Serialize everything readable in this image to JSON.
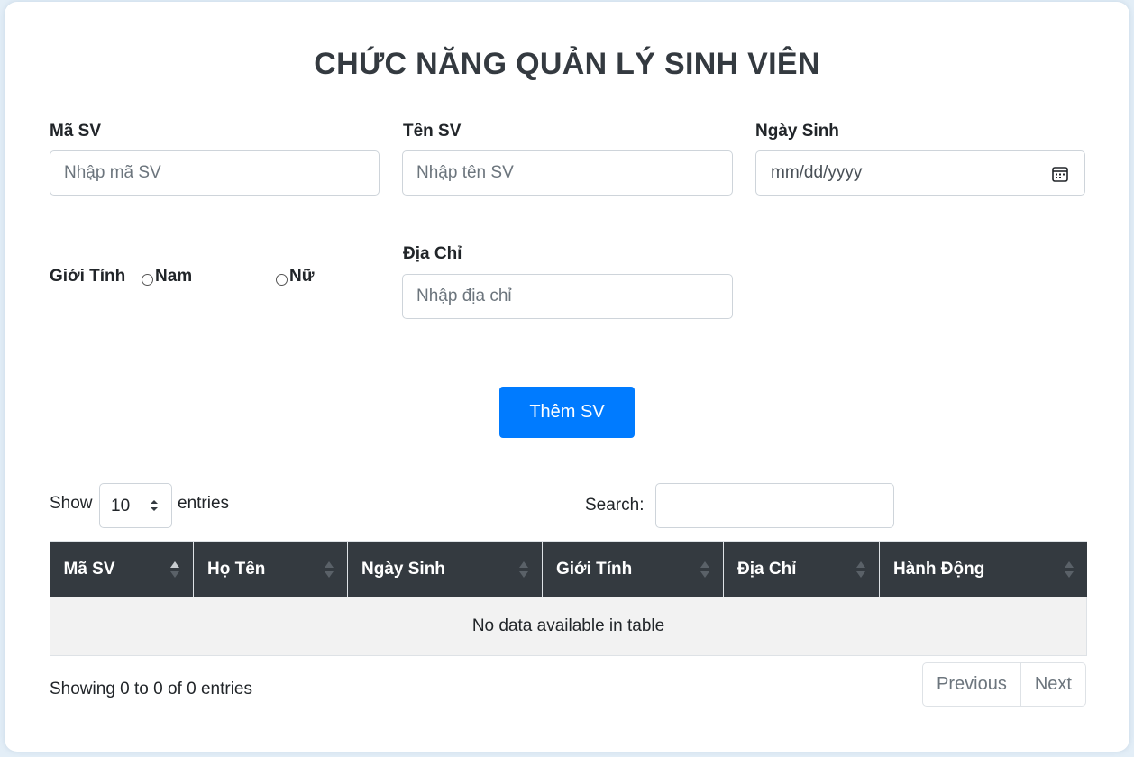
{
  "title": "CHỨC NĂNG QUẢN LÝ SINH VIÊN",
  "form": {
    "ma_sv_label": "Mã SV",
    "ma_sv_placeholder": "Nhập mã SV",
    "ten_sv_label": "Tên SV",
    "ten_sv_placeholder": "Nhập tên SV",
    "ngay_sinh_label": "Ngày Sinh",
    "ngay_sinh_value": "mm/dd/yyyy",
    "gioi_tinh_label": "Giới Tính",
    "gender_options": [
      "Nam",
      "Nữ"
    ],
    "dia_chi_label": "Địa Chỉ",
    "dia_chi_placeholder": "Nhập địa chỉ",
    "submit_label": "Thêm SV"
  },
  "datatable": {
    "show_label": "Show",
    "page_length": "10",
    "entries_label": "entries",
    "search_label": "Search:",
    "columns": [
      "Mã SV",
      "Họ Tên",
      "Ngày Sinh",
      "Giới Tính",
      "Địa Chỉ",
      "Hành Động"
    ],
    "empty_message": "No data available in table",
    "info": "Showing 0 to 0 of 0 entries",
    "prev_label": "Previous",
    "next_label": "Next"
  },
  "colors": {
    "primary": "#007bff",
    "table_header": "#343a40",
    "background": "#e3eef7"
  },
  "icons": [
    "calendar-icon",
    "select-arrows-icon",
    "sort-icon",
    "sort-asc-icon"
  ]
}
